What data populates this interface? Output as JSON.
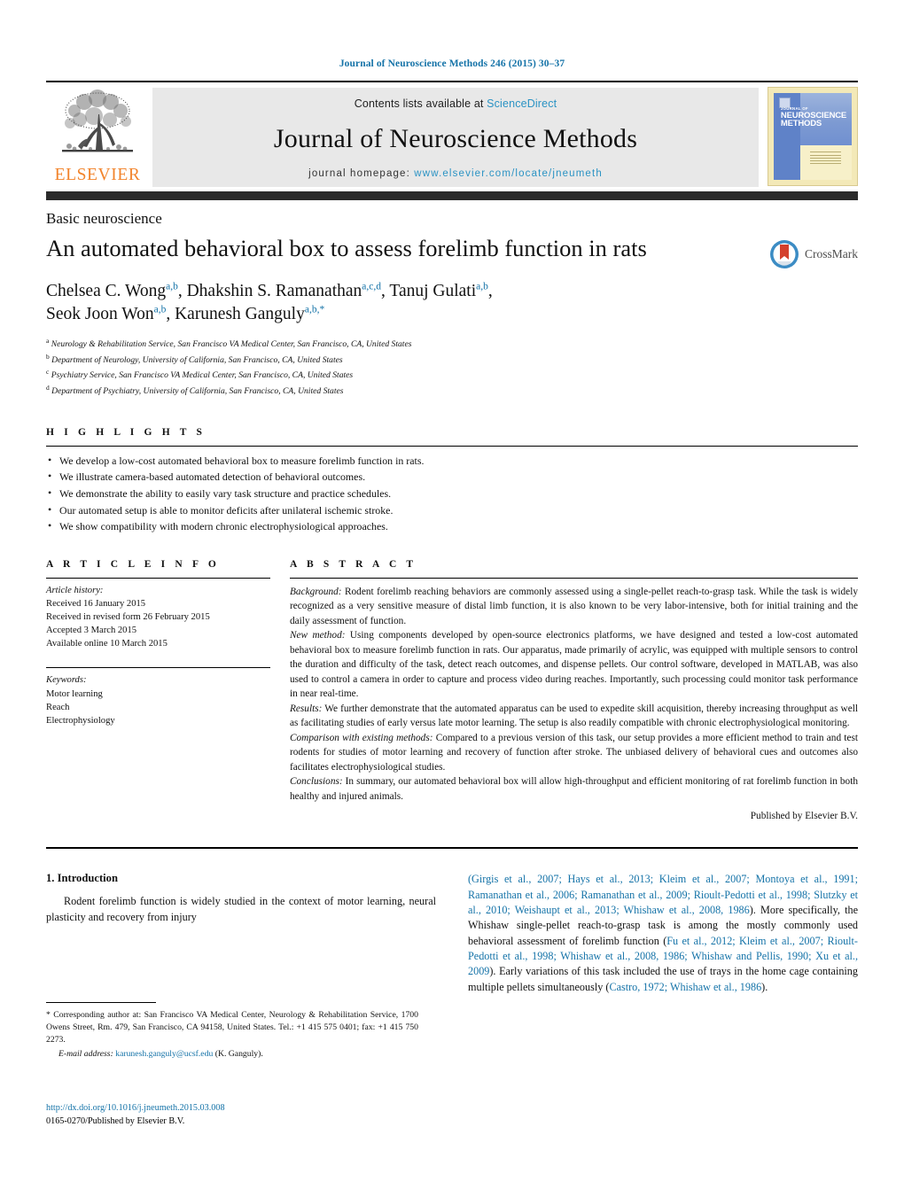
{
  "running_head": "Journal of Neuroscience Methods 246 (2015) 30–37",
  "masthead": {
    "contents_prefix": "Contents lists available at ",
    "contents_link": "ScienceDirect",
    "journal_name": "Journal of Neuroscience Methods",
    "homepage_prefix": "journal homepage: ",
    "homepage_link": "www.elsevier.com/locate/jneumeth",
    "publisher_logo_word": "ELSEVIER",
    "cover": {
      "line1": "JOURNAL OF",
      "line2": "NEUROSCIENCE METHODS"
    },
    "accent_link_color": "#2b93c4",
    "elsevier_orange": "#f2842c"
  },
  "article": {
    "section_label": "Basic neuroscience",
    "title": "An automated behavioral box to assess forelimb function in rats",
    "crossmark_label": "CrossMark",
    "authors_line1": "Chelsea C. Wong",
    "authors_sup1": "a,b",
    "authors_line2": ", Dhakshin S. Ramanathan",
    "authors_sup2": "a,c,d",
    "authors_line3": ", Tanuj Gulati",
    "authors_sup3": "a,b",
    "authors_line4": ",",
    "authors_line5": "Seok Joon Won",
    "authors_sup5": "a,b",
    "authors_line6": ", Karunesh Ganguly",
    "authors_sup6": "a,b,*",
    "affiliations": [
      {
        "marker": "a",
        "text": "Neurology & Rehabilitation Service, San Francisco VA Medical Center, San Francisco, CA, United States"
      },
      {
        "marker": "b",
        "text": "Department of Neurology, University of California, San Francisco, CA, United States"
      },
      {
        "marker": "c",
        "text": "Psychiatry Service, San Francisco VA Medical Center, San Francisco, CA, United States"
      },
      {
        "marker": "d",
        "text": "Department of Psychiatry, University of California, San Francisco, CA, United States"
      }
    ]
  },
  "highlights": {
    "heading": "H I G H L I G H T S",
    "items": [
      "We develop a low-cost automated behavioral box to measure forelimb function in rats.",
      "We illustrate camera-based automated detection of behavioral outcomes.",
      "We demonstrate the ability to easily vary task structure and practice schedules.",
      "Our automated setup is able to monitor deficits after unilateral ischemic stroke.",
      "We show compatibility with modern chronic electrophysiological approaches."
    ]
  },
  "article_info": {
    "heading": "A R T I C L E    I N F O",
    "history_label": "Article history:",
    "history": [
      "Received 16 January 2015",
      "Received in revised form 26 February 2015",
      "Accepted 3 March 2015",
      "Available online 10 March 2015"
    ],
    "keywords_label": "Keywords:",
    "keywords": [
      "Motor learning",
      "Reach",
      "Electrophysiology"
    ]
  },
  "abstract": {
    "heading": "A B S T R A C T",
    "background_label": "Background:",
    "background_text": " Rodent forelimb reaching behaviors are commonly assessed using a single-pellet reach-to-grasp task. While the task is widely recognized as a very sensitive measure of distal limb function, it is also known to be very labor-intensive, both for initial training and the daily assessment of function.",
    "newmethod_label": "New method:",
    "newmethod_text": " Using components developed by open-source electronics platforms, we have designed and tested a low-cost automated behavioral box to measure forelimb function in rats. Our apparatus, made primarily of acrylic, was equipped with multiple sensors to control the duration and difficulty of the task, detect reach outcomes, and dispense pellets. Our control software, developed in MATLAB, was also used to control a camera in order to capture and process video during reaches. Importantly, such processing could monitor task performance in near real-time.",
    "results_label": "Results:",
    "results_text": " We further demonstrate that the automated apparatus can be used to expedite skill acquisition, thereby increasing throughput as well as facilitating studies of early versus late motor learning. The setup is also readily compatible with chronic electrophysiological monitoring.",
    "comparison_label": "Comparison with existing methods:",
    "comparison_text": " Compared to a previous version of this task, our setup provides a more efficient method to train and test rodents for studies of motor learning and recovery of function after stroke. The unbiased delivery of behavioral cues and outcomes also facilitates electrophysiological studies.",
    "conclusions_label": "Conclusions:",
    "conclusions_text": " In summary, our automated behavioral box will allow high-throughput and efficient monitoring of rat forelimb function in both healthy and injured animals.",
    "published_by": "Published by Elsevier B.V."
  },
  "introduction": {
    "heading": "1.  Introduction",
    "left_paragraph": "Rodent forelimb function is widely studied in the context of motor learning, neural plasticity and recovery from injury",
    "right_ref1": "(Girgis et al., 2007; Hays et al., 2013; Kleim et al., 2007; Montoya et al., 1991; Ramanathan et al., 2006; Ramanathan et al., 2009; Rioult-Pedotti et al., 1998; Slutzky et al., 2010; Weishaupt et al., 2013; Whishaw et al., 2008, 1986",
    "right_text1": "). More specifically, the Whishaw single-pellet reach-to-grasp task is among the mostly commonly used behavioral assessment of forelimb function (",
    "right_ref2": "Fu et al., 2012; Kleim et al., 2007; Rioult-Pedotti et al., 1998; Whishaw et al., 2008, 1986; Whishaw and Pellis, 1990; Xu et al., 2009",
    "right_text2": "). Early variations of this task included the use of trays in the home cage containing multiple pellets simultaneously (",
    "right_ref3": "Castro, 1972; Whishaw et al., 1986",
    "right_text3": ")."
  },
  "footnote": {
    "star": "*",
    "text_before_email": " Corresponding author at: San Francisco VA Medical Center, Neurology & Rehabilitation Service, 1700 Owens Street, Rm. 479, San Francisco, CA 94158, United States. Tel.: +1 415 575 0401; fax: +1 415 750 2273.",
    "email_label": "E-mail address:",
    "email": "karunesh.ganguly@ucsf.edu",
    "email_suffix": " (K. Ganguly)."
  },
  "doi_block": {
    "doi": "http://dx.doi.org/10.1016/j.jneumeth.2015.03.008",
    "issn_line": "0165-0270/Published by Elsevier B.V."
  }
}
